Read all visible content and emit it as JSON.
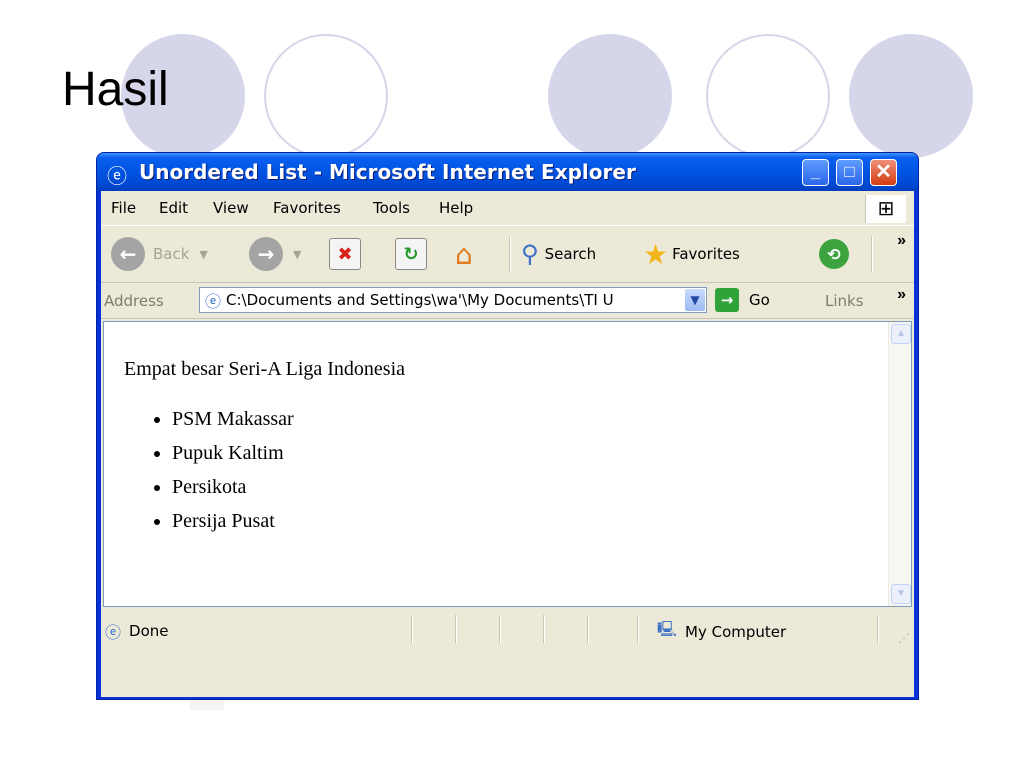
{
  "slide": {
    "title": "Hasil",
    "decorative_circles": [
      "filled",
      "outline",
      "filled",
      "outline",
      "filled"
    ],
    "circle_color": "#d6d6eb"
  },
  "window": {
    "title": "Unordered List - Microsoft Internet Explorer",
    "icon": "ie-icon",
    "controls": {
      "minimize": "minimize-icon",
      "maximize": "maximize-icon",
      "close": "close-icon"
    },
    "colors": {
      "titlebar": "#0054e3",
      "chrome": "#ece9d8",
      "close": "#d43a12"
    }
  },
  "menu": [
    "File",
    "Edit",
    "View",
    "Favorites",
    "Tools",
    "Help"
  ],
  "toolbar": {
    "back": "Back",
    "search": "Search",
    "favorites": "Favorites",
    "icons": [
      "back-icon",
      "forward-icon",
      "stop-icon",
      "refresh-icon",
      "home-icon",
      "search-icon",
      "favorites-star-icon",
      "history-icon"
    ]
  },
  "address": {
    "label": "Address",
    "value": "C:\\Documents and Settings\\wa'\\My Documents\\TI U",
    "go": "Go",
    "links": "Links"
  },
  "page": {
    "heading": "Empat besar Seri-A Liga Indonesia",
    "list": [
      "PSM Makassar",
      "Pupuk Kaltim",
      "Persikota",
      "Persija Pusat"
    ]
  },
  "status": {
    "text": "Done",
    "zone": "My Computer"
  }
}
